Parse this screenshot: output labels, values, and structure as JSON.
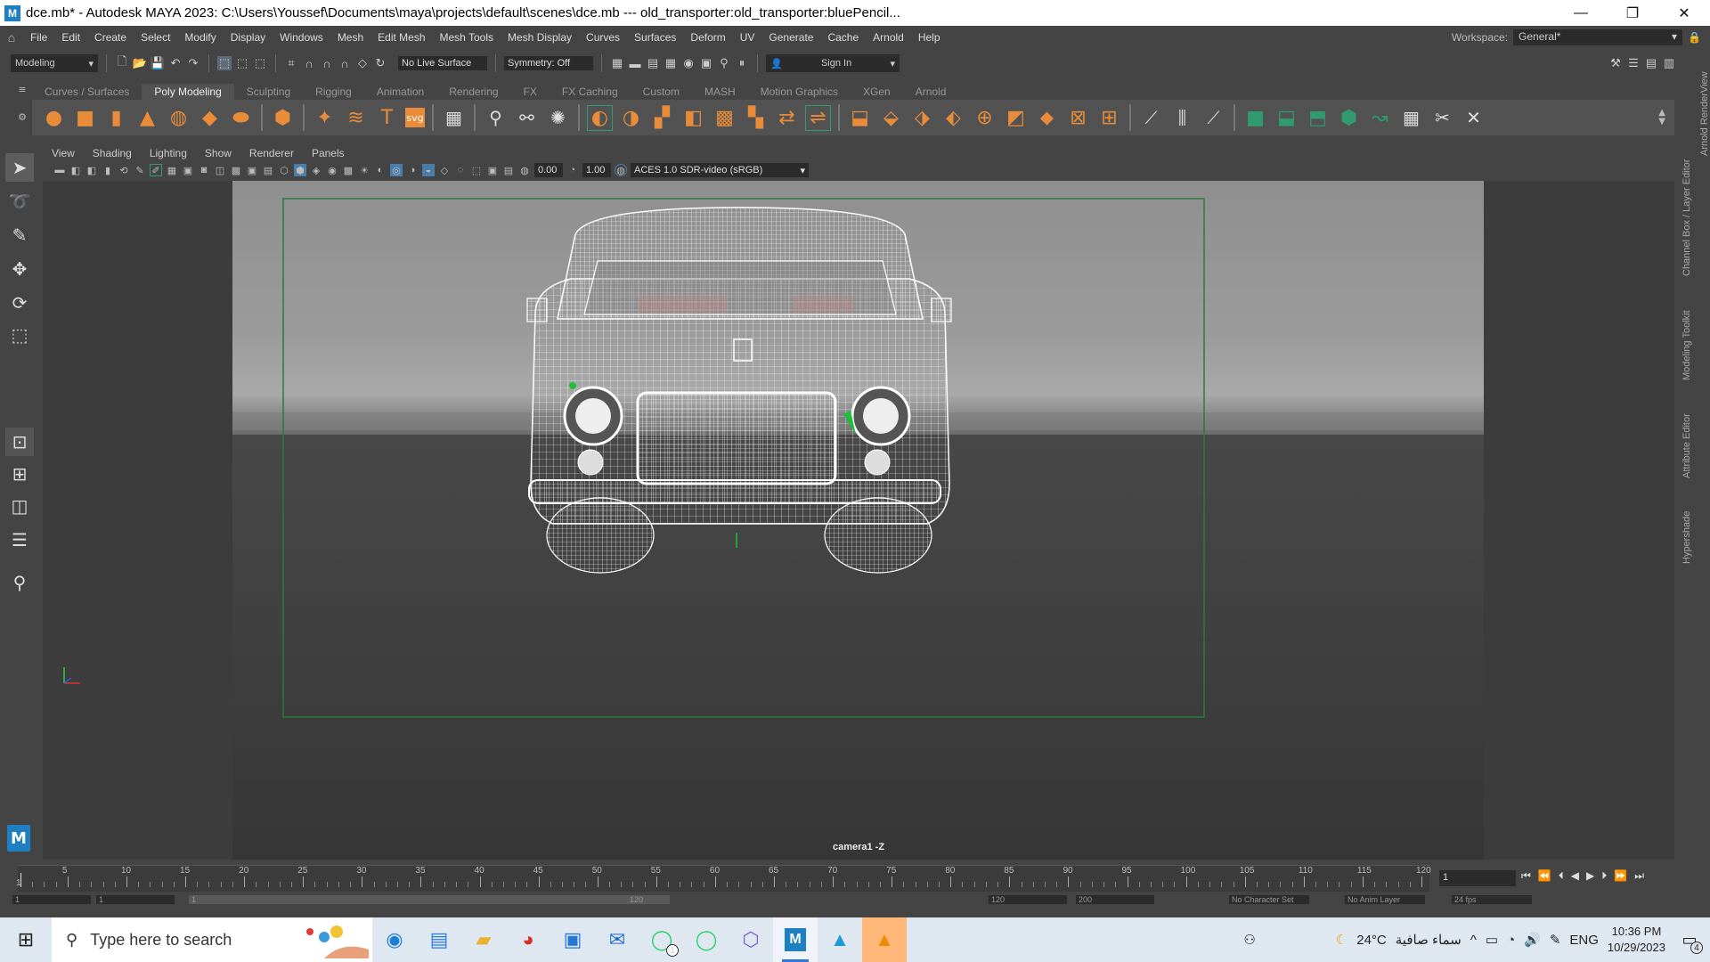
{
  "titlebar": {
    "app_icon": "M",
    "title": "dce.mb* - Autodesk MAYA 2023: C:\\Users\\Youssef\\Documents\\maya\\projects\\default\\scenes\\dce.mb   ---   old_transporter:old_transporter:bluePencil...",
    "minimize": "—",
    "restore": "❐",
    "close": "✕"
  },
  "menubar": {
    "items": [
      "File",
      "Edit",
      "Create",
      "Select",
      "Modify",
      "Display",
      "Windows",
      "Mesh",
      "Edit Mesh",
      "Mesh Tools",
      "Mesh Display",
      "Curves",
      "Surfaces",
      "Deform",
      "UV",
      "Generate",
      "Cache",
      "Arnold",
      "Help"
    ],
    "workspace_label": "Workspace:",
    "workspace_value": "General*"
  },
  "statusline": {
    "menuset": "Modeling",
    "live_surface": "No Live Surface",
    "symmetry": "Symmetry: Off",
    "sign_in": "Sign In"
  },
  "shelf": {
    "tabs": [
      "Curves / Surfaces",
      "Poly Modeling",
      "Sculpting",
      "Rigging",
      "Animation",
      "Rendering",
      "FX",
      "FX Caching",
      "Custom",
      "MASH",
      "Motion Graphics",
      "XGen",
      "Arnold"
    ],
    "active_tab": "Poly Modeling",
    "text_tool": "T",
    "svg_tool": "svg"
  },
  "panel": {
    "menus": [
      "View",
      "Shading",
      "Lighting",
      "Show",
      "Renderer",
      "Panels"
    ],
    "exposure": "0.00",
    "gamma": "1.00",
    "color_space": "ACES 1.0 SDR-video (sRGB)",
    "camera_label": "camera1 -Z"
  },
  "right_tabs": [
    "Arnold RenderView",
    "Channel Box / Layer Editor",
    "Modeling Toolkit",
    "Attribute Editor",
    "Hypershade"
  ],
  "timeline": {
    "ticks": [
      "5",
      "10",
      "15",
      "20",
      "25",
      "30",
      "35",
      "40",
      "45",
      "50",
      "55",
      "60",
      "65",
      "70",
      "75",
      "80",
      "85",
      "90",
      "95",
      "100",
      "105",
      "110",
      "115",
      "120"
    ],
    "start_label": "1",
    "current_frame": "1",
    "range_start": "1",
    "range_inner_start": "1",
    "range_inner_end": "120",
    "range_end": "120",
    "anim_end": "200",
    "character_set": "No Character Set",
    "anim_layer": "No Anim Layer",
    "fps": "24 fps"
  },
  "taskbar": {
    "search_placeholder": "Type here to search",
    "weather_temp": "24°C",
    "weather_text": "سماء صافية",
    "language": "ENG",
    "time": "10:36 PM",
    "date": "10/29/2023",
    "notifications": "4",
    "whatsapp_badge": "1",
    "maya_label": "M"
  },
  "colors": {
    "maya_blue": "#1e7fc2",
    "shelf_orange": "#e88c3a",
    "resolution_gate": "#2d7a3a"
  }
}
